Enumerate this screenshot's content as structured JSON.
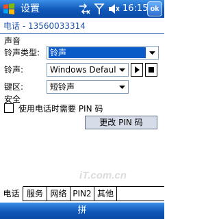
{
  "titlebar": {
    "title": "设置",
    "time": "16:15",
    "ok_label": "ok",
    "icons": [
      "windows-start-icon",
      "connectivity-icon",
      "signal-icon",
      "volume-icon"
    ]
  },
  "header": {
    "text": "电话 - 13560033314"
  },
  "sound": {
    "section_label": "声音",
    "ring_type_label": "铃声类型:",
    "ring_type_value": "铃声",
    "ringtone_label": "铃声:",
    "ringtone_value": "Windows Default",
    "keypad_label": "键区:",
    "keypad_value": "短铃声"
  },
  "security": {
    "section_label": "安全",
    "require_pin_label": "使用电话时需要 PIN 码",
    "require_pin_checked": false,
    "change_pin_label": "更改 PIN 码"
  },
  "watermark": "iT.com.cn",
  "tabs": [
    {
      "label": "电话",
      "active": true
    },
    {
      "label": "服务",
      "active": false
    },
    {
      "label": "网络",
      "active": false
    },
    {
      "label": "PIN2",
      "active": false
    },
    {
      "label": "其他",
      "active": false
    }
  ],
  "menubar": {
    "input_label": "拼"
  },
  "colors": {
    "titlebar": "#1057b8",
    "selection": "#0a5ac8",
    "header_text": "#1a4fa8"
  }
}
